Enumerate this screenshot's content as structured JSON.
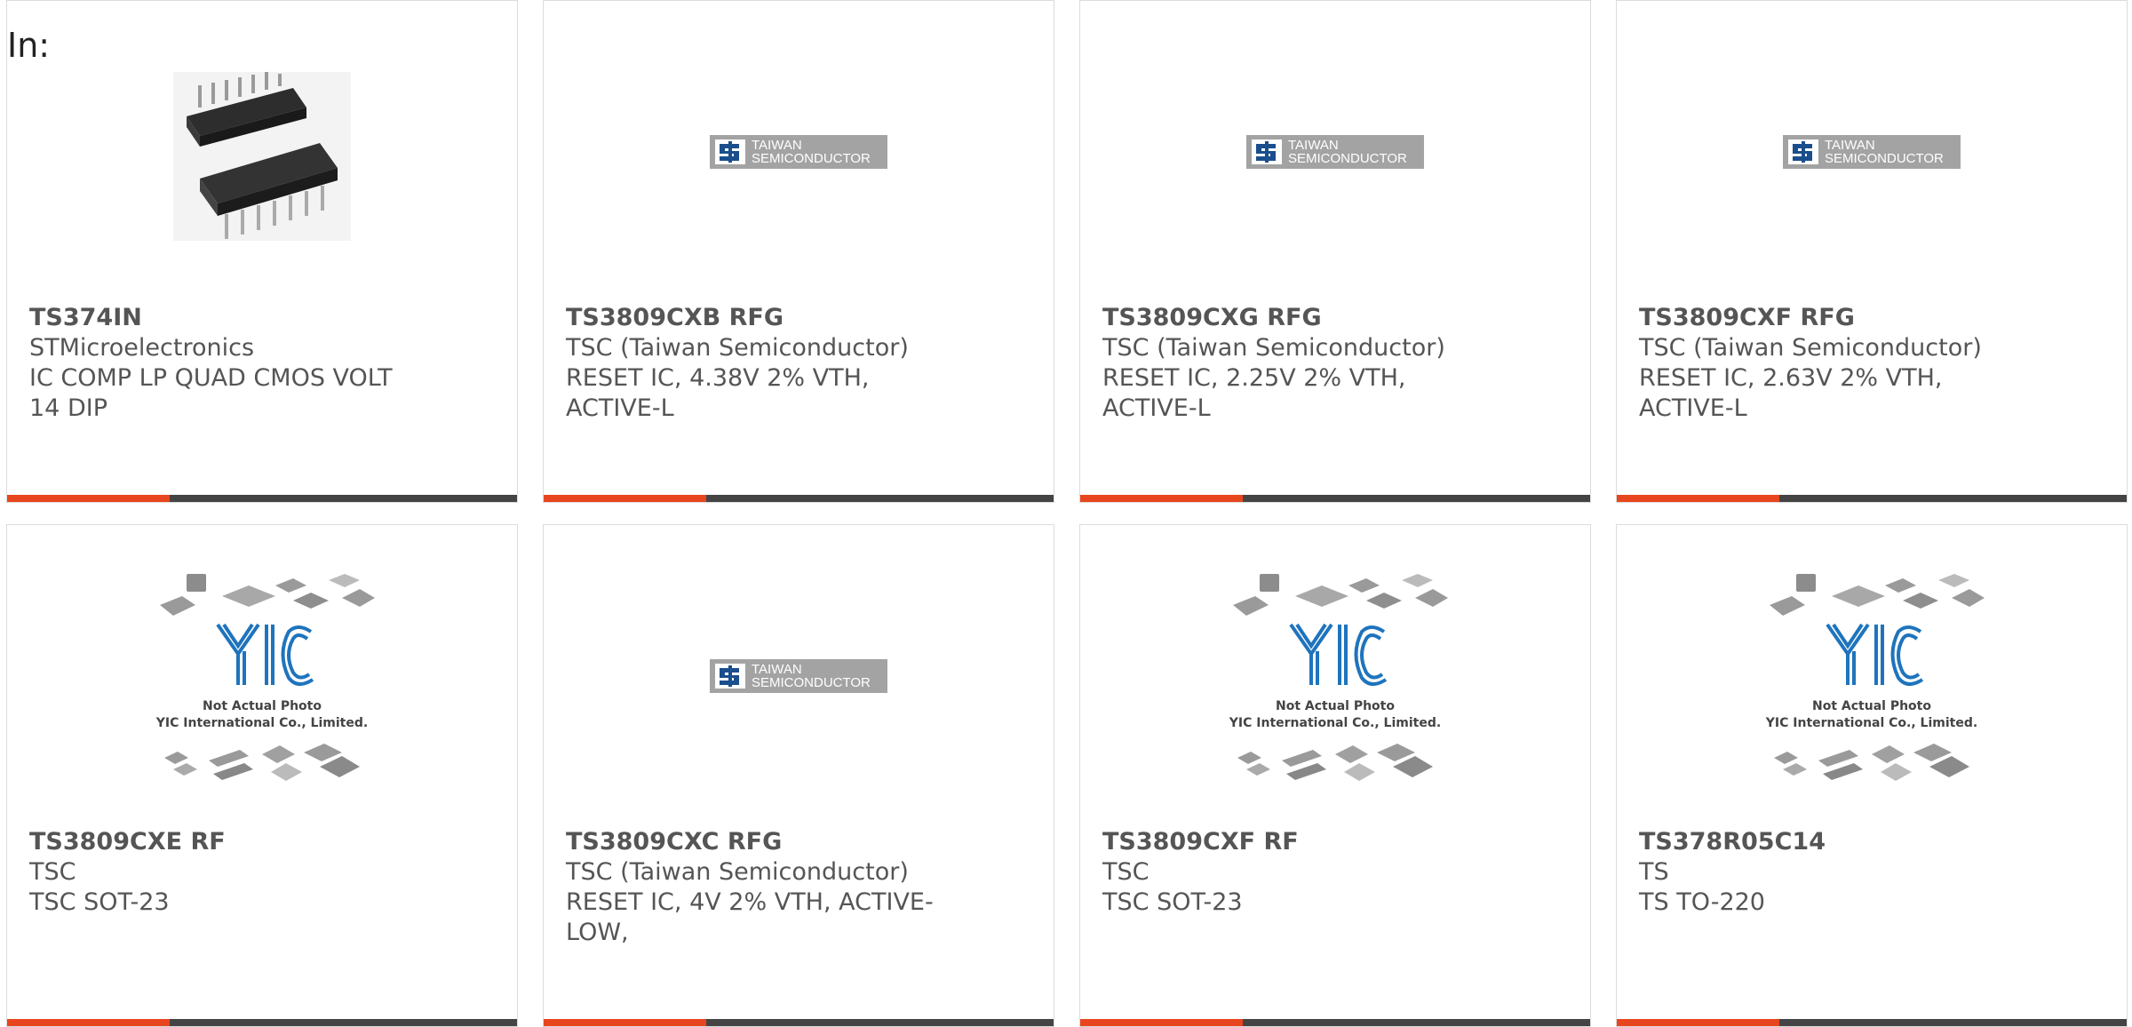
{
  "header": {
    "label": "In:"
  },
  "colors": {
    "accent": "#e8461e",
    "bar": "#444444"
  },
  "cards": [
    {
      "part": "TS374IN",
      "maker": "STMicroelectronics",
      "desc": "IC COMP LP QUAD CMOS VOLT 14 DIP",
      "image": "dip-chip-photo"
    },
    {
      "part": "TS3809CXB RFG",
      "maker": "TSC (Taiwan Semiconductor)",
      "desc": "RESET IC, 4.38V 2% VTH, ACTIVE-L",
      "image": "taiwan-semiconductor-logo"
    },
    {
      "part": "TS3809CXG RFG",
      "maker": "TSC (Taiwan Semiconductor)",
      "desc": "RESET IC, 2.25V 2% VTH, ACTIVE-L",
      "image": "taiwan-semiconductor-logo"
    },
    {
      "part": "TS3809CXF RFG",
      "maker": "TSC (Taiwan Semiconductor)",
      "desc": "RESET IC, 2.63V 2% VTH, ACTIVE-L",
      "image": "taiwan-semiconductor-logo"
    },
    {
      "part": "TS3809CXE RF",
      "maker": "TSC",
      "desc": "TSC SOT-23",
      "image": "not-actual-photo"
    },
    {
      "part": "TS3809CXC RFG",
      "maker": "TSC (Taiwan Semiconductor)",
      "desc": "RESET IC, 4V 2% VTH, ACTIVE-LOW,",
      "image": "taiwan-semiconductor-logo"
    },
    {
      "part": "TS3809CXF RF",
      "maker": "TSC",
      "desc": "TSC SOT-23",
      "image": "not-actual-photo"
    },
    {
      "part": "TS378R05C14",
      "maker": "TS",
      "desc": "TS TO-220",
      "image": "not-actual-photo"
    }
  ],
  "logos": {
    "tsc_line1": "TAIWAN",
    "tsc_line2": "SEMICONDUCTOR",
    "yic_mark": "YIC",
    "yic_line1": "Not Actual Photo",
    "yic_line2": "YIC International Co., Limited."
  }
}
